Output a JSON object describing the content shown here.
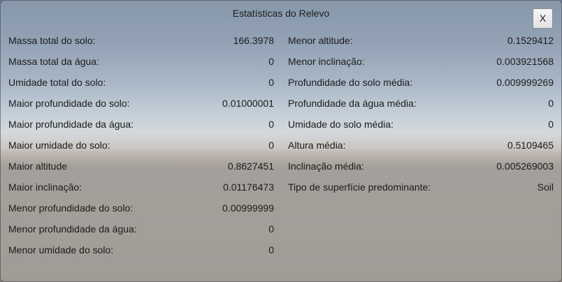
{
  "window": {
    "title": "Estatísticas do Relevo",
    "close_label": "X"
  },
  "left_stats": [
    {
      "label": "Massa total do solo:",
      "value": "166.3978"
    },
    {
      "label": "Massa total da água:",
      "value": "0"
    },
    {
      "label": "Umidade total do solo:",
      "value": "0"
    },
    {
      "label": "Maior profundidade do solo:",
      "value": "0.01000001"
    },
    {
      "label": "Maior profundidade da água:",
      "value": "0"
    },
    {
      "label": "Maior umidade do solo:",
      "value": "0"
    },
    {
      "label": "Maior altitude",
      "value": "0.8627451"
    },
    {
      "label": "Maior inclinação:",
      "value": "0.01176473"
    },
    {
      "label": "Menor profundidade do solo:",
      "value": "0.00999999"
    },
    {
      "label": "Menor profundidade da água:",
      "value": "0"
    },
    {
      "label": "Menor umidade do solo:",
      "value": "0"
    }
  ],
  "right_stats": [
    {
      "label": "Menor altitude:",
      "value": "0.1529412"
    },
    {
      "label": "Menor inclinação:",
      "value": "0.003921568"
    },
    {
      "label": "Profundidade do solo média:",
      "value": "0.009999269"
    },
    {
      "label": "Profundidade da água média:",
      "value": "0"
    },
    {
      "label": "Umidade do solo média:",
      "value": "0"
    },
    {
      "label": "Altura média:",
      "value": "0.5109465"
    },
    {
      "label": "Inclinação média:",
      "value": "0.005269003"
    },
    {
      "label": "Tipo de superfície predominante:",
      "value": "Soil"
    }
  ]
}
